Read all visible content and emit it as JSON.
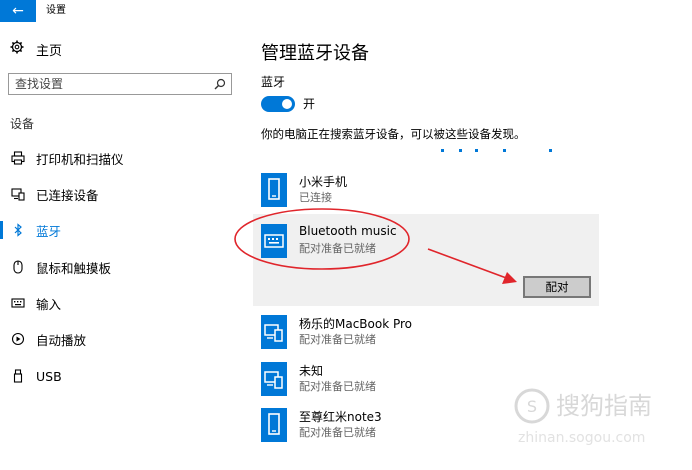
{
  "window": {
    "title": "设置",
    "back_label": "←"
  },
  "sidebar": {
    "home_label": "主页",
    "search_placeholder": "查找设置",
    "section_label": "设备",
    "items": [
      {
        "label": "打印机和扫描仪",
        "icon": "printer-icon"
      },
      {
        "label": "已连接设备",
        "icon": "connected-devices-icon"
      },
      {
        "label": "蓝牙",
        "icon": "bluetooth-icon",
        "active": true
      },
      {
        "label": "鼠标和触摸板",
        "icon": "mouse-icon"
      },
      {
        "label": "输入",
        "icon": "keyboard-icon"
      },
      {
        "label": "自动播放",
        "icon": "autoplay-icon"
      },
      {
        "label": "USB",
        "icon": "usb-icon"
      }
    ]
  },
  "main": {
    "title": "管理蓝牙设备",
    "bluetooth_label": "蓝牙",
    "toggle_state": "开",
    "searching_text": "你的电脑正在搜索蓝牙设备，可以被这些设备发现。",
    "devices": [
      {
        "name": "小米手机",
        "status": "已连接",
        "icon": "phone-icon"
      },
      {
        "name": "Bluetooth music",
        "status": "配对准备已就绪",
        "icon": "keyboard-device-icon",
        "selected": true
      },
      {
        "name": "杨乐的MacBook Pro",
        "status": "配对准备已就绪",
        "icon": "computer-phone-icon"
      },
      {
        "name": "未知",
        "status": "配对准备已就绪",
        "icon": "computer-phone-icon"
      },
      {
        "name": "至尊红米note3",
        "status": "配对准备已就绪",
        "icon": "phone-icon"
      }
    ],
    "pair_button_label": "配对"
  },
  "colors": {
    "accent": "#0078d7",
    "annotation": "#e0252b"
  }
}
